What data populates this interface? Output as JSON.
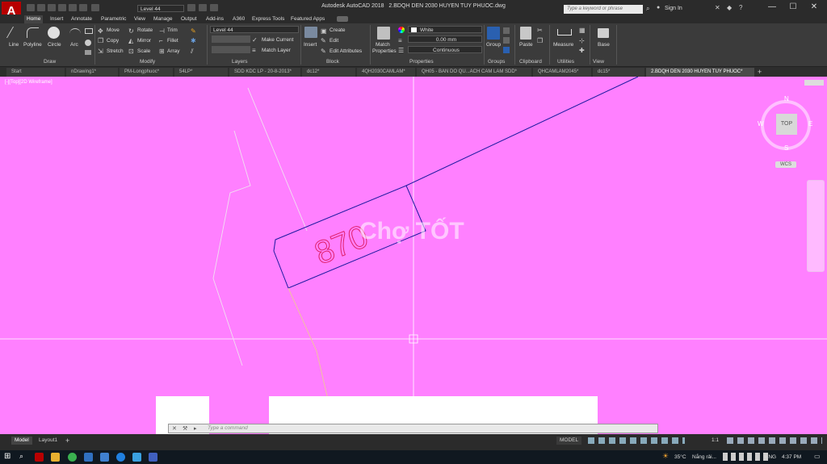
{
  "app_title": "Autodesk AutoCAD 2018",
  "doc_title": "2.BDQH DEN 2030 HUYEN TUY PHUOC.dwg",
  "app_logo": "A",
  "quick_access_layer": "Level 44",
  "search_placeholder": "Type a keyword or phrase",
  "signin": "Sign In",
  "ribbon_tabs": [
    "Home",
    "Insert",
    "Annotate",
    "Parametric",
    "View",
    "Manage",
    "Output",
    "Add-ins",
    "A360",
    "Express Tools",
    "Featured Apps"
  ],
  "draw": {
    "line": "Line",
    "polyline": "Polyline",
    "circle": "Circle",
    "arc": "Arc",
    "label": "Draw"
  },
  "modify": {
    "move": "Move",
    "rotate": "Rotate",
    "trim": "Trim",
    "copy": "Copy",
    "mirror": "Mirror",
    "fillet": "Fillet",
    "stretch": "Stretch",
    "scale": "Scale",
    "array": "Array",
    "label": "Modify"
  },
  "layers": {
    "current": "Level 44",
    "make_current": "Make Current",
    "match_layer": "Match Layer",
    "label": "Layers"
  },
  "block": {
    "insert": "Insert",
    "create": "Create",
    "edit": "Edit",
    "edit_attributes": "Edit Attributes",
    "label": "Block"
  },
  "properties": {
    "match": "Match",
    "match2": "Properties",
    "color": "White",
    "lineweight": "0.00 mm",
    "linetype": "Continuous",
    "label": "Properties"
  },
  "groups": {
    "group": "Group",
    "label": "Groups"
  },
  "clipboard": {
    "paste": "Paste",
    "label": "Clipboard"
  },
  "utilities": {
    "measure": "Measure",
    "label": "Utilities"
  },
  "view_panel": {
    "base": "Base",
    "label": "View"
  },
  "doc_tabs": [
    "Start",
    "nDrawing1*",
    "PM-Longphuoc*",
    "54LP*",
    "SDD KDC LP - 20-8-2013*",
    "dc12*",
    "4QH2030CAMLAM*",
    "QH05 - BAN DO QU...ACH CAM LAM SDD*",
    "QHCAMLAM2045*",
    "dc15*",
    "2.BDQH DEN 2030 HUYEN TUY PHUOC*"
  ],
  "viewport_label": "[-][Top][2D Wireframe]",
  "drawing_text": "870",
  "watermark": "Chợ TỐT",
  "viewcube": {
    "n": "N",
    "s": "S",
    "e": "E",
    "w": "W",
    "top": "TOP",
    "wcs": "WCS"
  },
  "command_placeholder": "Type a command",
  "layout_tabs": [
    "Model",
    "Layout1"
  ],
  "status": {
    "model": "MODEL",
    "scale": "1:1"
  },
  "tray": {
    "temp": "35°C",
    "weather": "Nắng rải...",
    "lang": "ENG",
    "time": "4:37 PM"
  },
  "colors": {
    "canvas": "#ff80ff",
    "line_blue": "#1a1aa0",
    "text_red": "#e0206a"
  }
}
